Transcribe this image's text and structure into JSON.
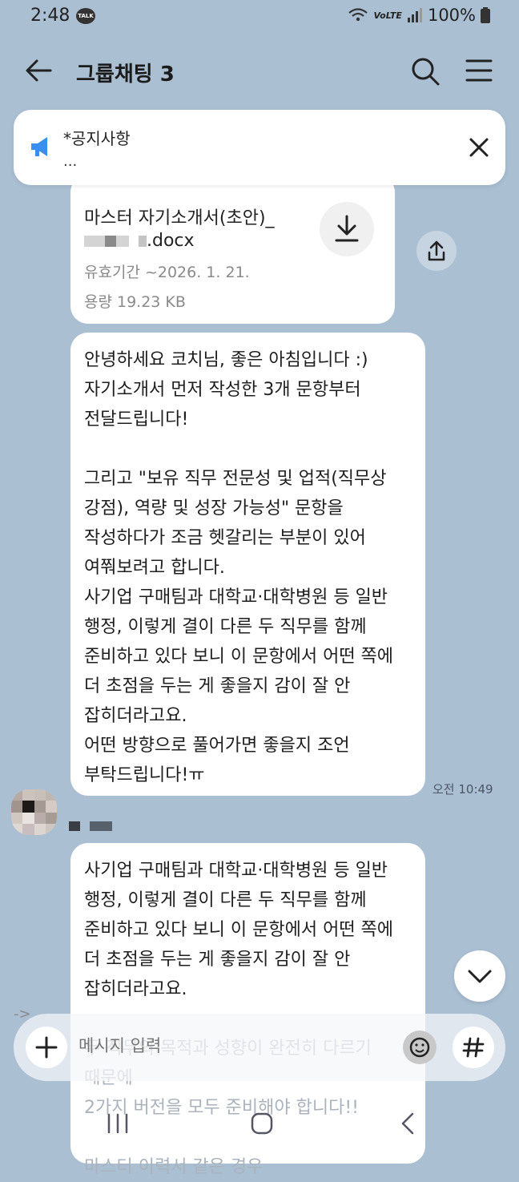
{
  "status_bar": {
    "time": "2:48",
    "talk_badge": "TALK",
    "network": "VoLTE",
    "battery": "100%"
  },
  "header": {
    "title": "그룹채팅 3"
  },
  "notice": {
    "title": "*공지사항",
    "preview": "..."
  },
  "file_message": {
    "name_line1": "마스터 자기소개서(초안)_",
    "name_line2_suffix": ".docx",
    "expiry": "유효기간 ~2026. 1. 21.",
    "size": "용량  19.23 KB"
  },
  "message": {
    "text": "안녕하세요 코치님, 좋은 아침입니다 :)\n자기소개서 먼저 작성한 3개 문항부터\n전달드립니다!\n\n그리고 \"보유 직무 전문성 및 업적(직무상\n강점), 역량 및 성장 가능성\" 문항을\n작성하다가 조금 헷갈리는 부분이 있어\n여쭤보려고 합니다.\n사기업 구매팀과 대학교·대학병원 등 일반\n행정, 이렇게 결이 다른 두 직무를 함께\n준비하고 있다 보니 이 문항에서 어떤 쪽에\n더 초점을 두는 게 좋을지 감이 잘 안\n잡히더라고요.\n어떤 방향으로 풀어가면 좋을지 조언\n부탁드립니다!ㅠ",
    "time": "오전 10:49"
  },
  "reply": {
    "quote": "사기업 구매팀과 대학교·대학병원 등 일반\n행정, 이렇게 결이 다른 두 직무를 함께\n준비하고 있다 보니 이 문항에서 어떤 쪽에\n더 초점을 두는 게 좋을지 감이 잘 안\n잡히더라고요.",
    "arrow": "->",
    "faded": "두 직무의 목적과 성향이 완전히 다르기\n때문에\n2가지 버전을 모두 준비해야 합니다!!\n\n마스터 이력서 같은 경우"
  },
  "input": {
    "placeholder": "메시지 입력"
  },
  "colors": {
    "background": "#abbfd3",
    "bubble": "#ffffff",
    "notice_icon": "#3a8ef0"
  },
  "icons": {
    "back": "arrow-left-icon",
    "search": "search-icon",
    "menu": "hamburger-menu-icon",
    "notice": "megaphone-icon",
    "close": "close-icon",
    "download": "download-icon",
    "share": "share-icon",
    "scroll": "chevron-down-icon",
    "plus": "plus-icon",
    "emoji": "emoji-icon",
    "hash": "hash-icon"
  }
}
